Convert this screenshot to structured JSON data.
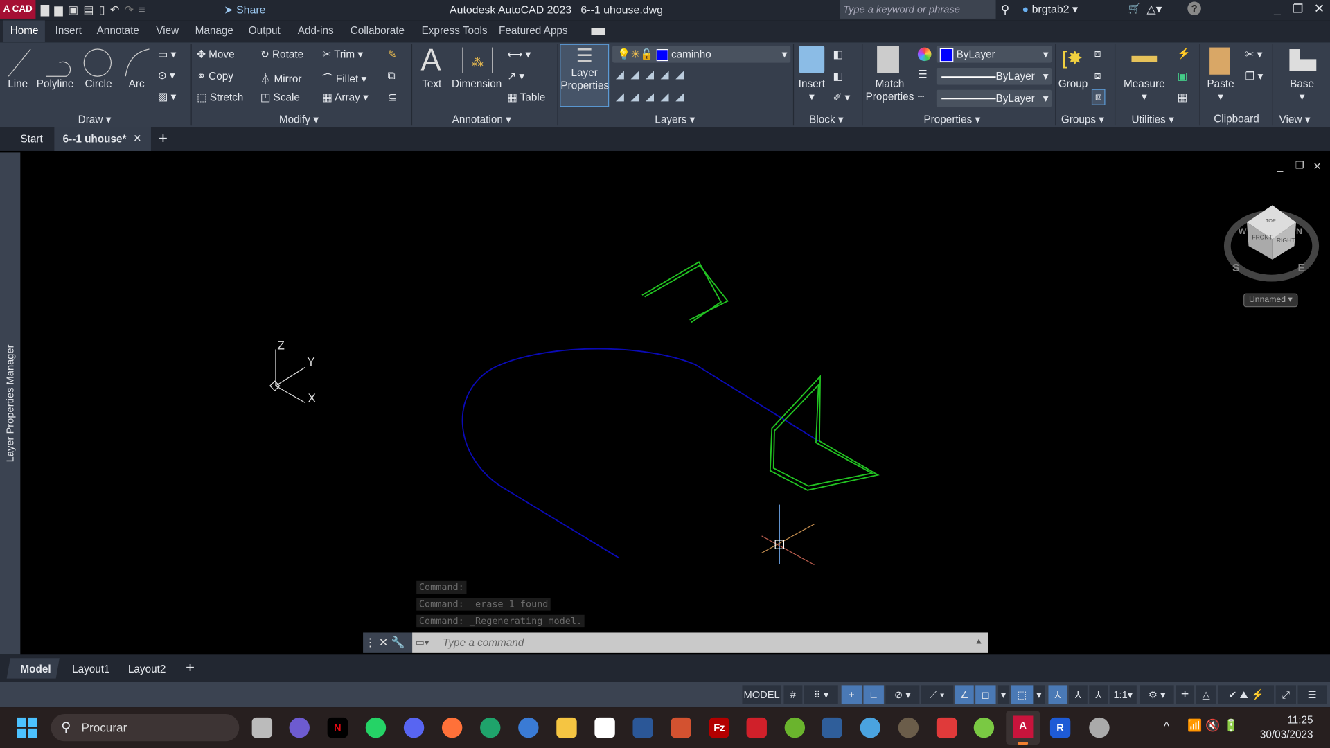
{
  "window": {
    "title": "Autodesk AutoCAD 2023",
    "filename": "6--1 uhouse.dwg",
    "logo_text": "A CAD",
    "share": "Share",
    "search_placeholder": "Type a keyword or phrase",
    "user": "brgtab2"
  },
  "menu_tabs": [
    "Home",
    "Insert",
    "Annotate",
    "View",
    "Manage",
    "Output",
    "Add-ins",
    "Collaborate",
    "Express Tools",
    "Featured Apps"
  ],
  "ribbon": {
    "draw": {
      "label": "Draw",
      "tools": [
        "Line",
        "Polyline",
        "Circle",
        "Arc"
      ]
    },
    "modify": {
      "label": "Modify",
      "tools": [
        "Move",
        "Rotate",
        "Trim",
        "Copy",
        "Mirror",
        "Fillet",
        "Stretch",
        "Scale",
        "Array"
      ]
    },
    "annotation": {
      "label": "Annotation",
      "tools": [
        "Text",
        "Dimension",
        "Table"
      ]
    },
    "layers": {
      "label": "Layers",
      "layer_properties": "Layer Properties",
      "current_layer": "caminho",
      "layer_color": "#0000ff"
    },
    "block": {
      "label": "Block",
      "insert": "Insert"
    },
    "properties": {
      "label": "Properties",
      "match": "Match Properties",
      "color": "ByLayer",
      "lineweight": "ByLayer",
      "linetype": "ByLayer"
    },
    "groups": {
      "label": "Groups",
      "group": "Group"
    },
    "utilities": {
      "label": "Utilities",
      "measure": "Measure"
    },
    "clipboard": {
      "label": "Clipboard",
      "paste": "Paste"
    },
    "view": {
      "label": "View",
      "base": "Base"
    }
  },
  "doc_tabs": [
    "Start",
    "6--1 uhouse*"
  ],
  "sidebar_label": "Layer Properties Manager",
  "ucs": {
    "x": "X",
    "y": "Y",
    "z": "Z"
  },
  "viewcube": {
    "top": "TOP",
    "front": "FRONT",
    "right": "RIGHT",
    "s": "S",
    "e": "E",
    "w": "W",
    "n": "N",
    "view_name": "Unnamed"
  },
  "colors": {
    "green_geometry": "#22c322",
    "blue_path": "#0a0ab4",
    "accent": "#4a79b5"
  },
  "command": {
    "history": [
      "Command:",
      "Command: _erase 1 found",
      "Command: _Regenerating model."
    ],
    "placeholder": "Type a command"
  },
  "layout_tabs": [
    "Model",
    "Layout1",
    "Layout2"
  ],
  "status": {
    "model": "MODEL",
    "scale": "1:1"
  },
  "taskbar": {
    "search": "Procurar",
    "time": "11:25",
    "date": "30/03/2023"
  }
}
